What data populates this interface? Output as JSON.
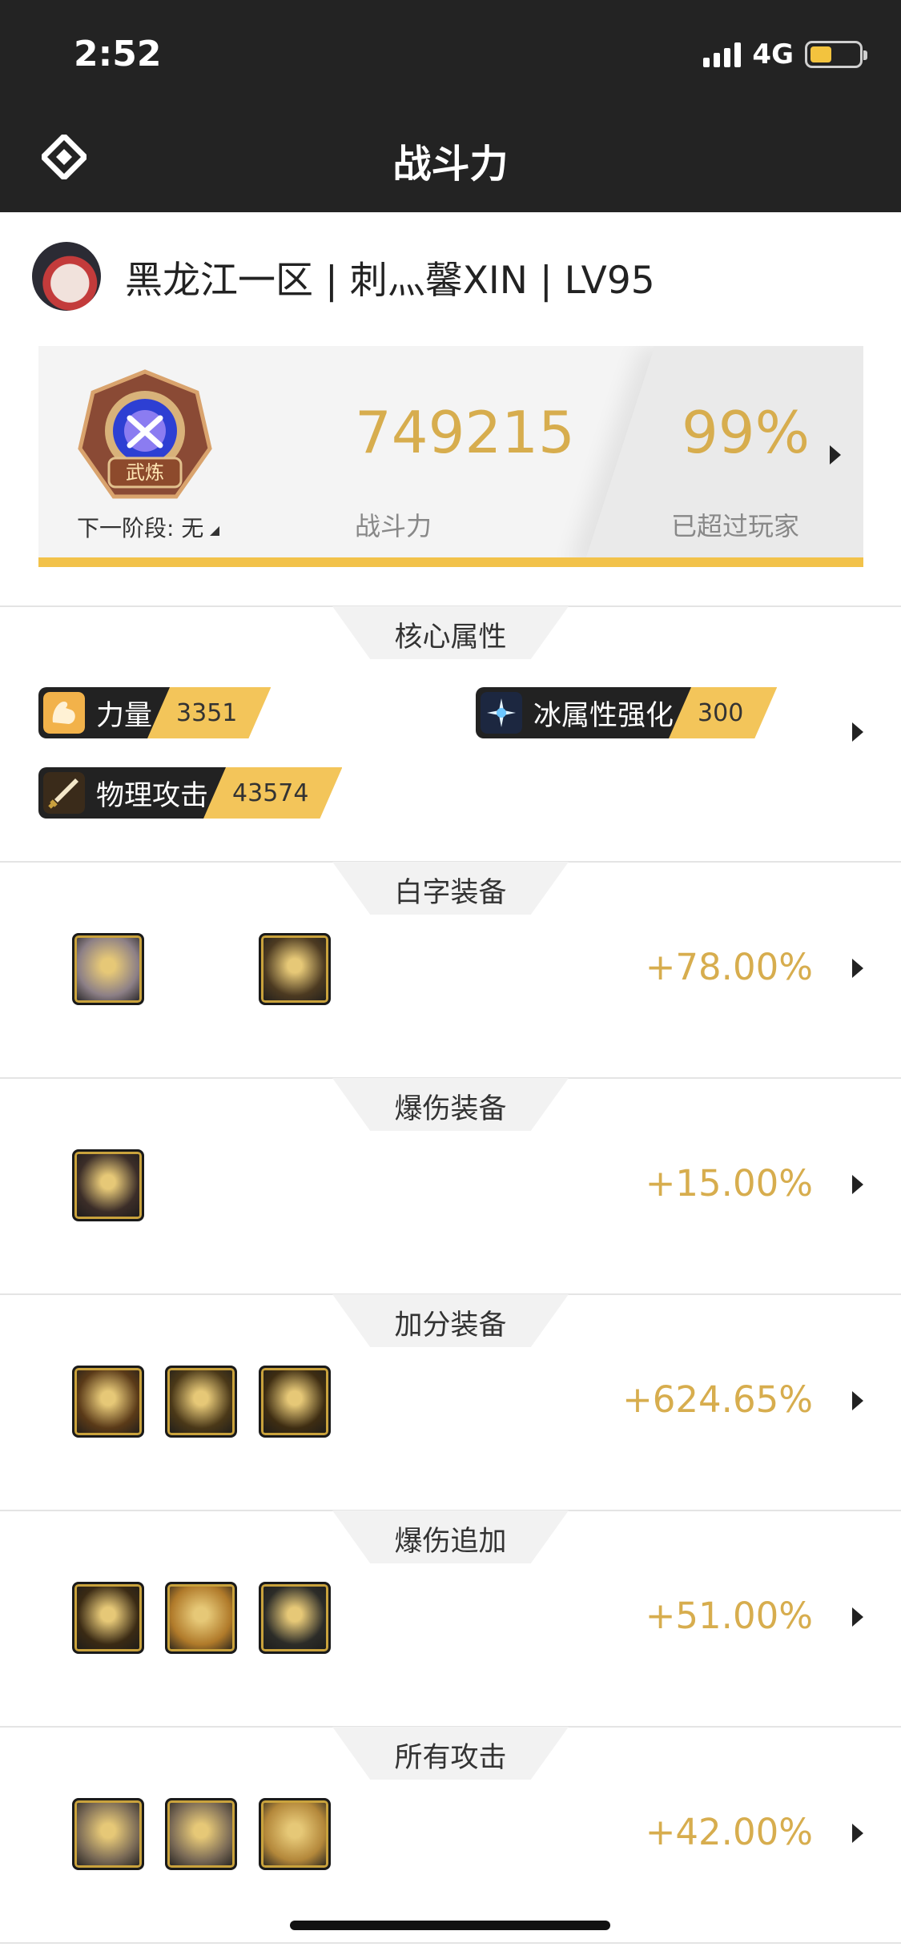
{
  "status_bar": {
    "time": "2:52",
    "network": "4G",
    "battery_level": 0.44
  },
  "nav": {
    "title": "战斗力",
    "logo_icon": "diamond-logo-icon"
  },
  "profile": {
    "name": "黑龙江一区 | 刺灬馨XIN | LV95",
    "avatar_icon": "character-avatar-icon"
  },
  "score_card": {
    "badge_text": "武炼",
    "next_stage": "下一阶段: 无",
    "score": "749215",
    "score_label": "战斗力",
    "percent": "99%",
    "percent_label": "已超过玩家"
  },
  "colors": {
    "accent": "#d7ad4e",
    "bar": "#f2c24a",
    "nav_bg": "#232323"
  },
  "core": {
    "title": "核心属性",
    "attrs": [
      {
        "label": "力量",
        "value": "3351",
        "icon": "strength-arm-icon"
      },
      {
        "label": "冰属性强化",
        "value": "300",
        "icon": "ice-sparkle-icon"
      },
      {
        "label": "物理攻击",
        "value": "43574",
        "icon": "sword-icon"
      }
    ]
  },
  "sections": [
    {
      "title": "白字装备",
      "bonus": "+78.00%",
      "items": [
        "white-equip-1-icon",
        "white-equip-2-icon"
      ]
    },
    {
      "title": "爆伤装备",
      "bonus": "+15.00%",
      "items": [
        "crit-equip-1-icon"
      ]
    },
    {
      "title": "加分装备",
      "bonus": "+624.65%",
      "items": [
        "bonus-equip-1-icon",
        "bonus-equip-2-icon",
        "bonus-equip-3-icon"
      ]
    },
    {
      "title": "爆伤追加",
      "bonus": "+51.00%",
      "items": [
        "crit-add-1-icon",
        "crit-add-2-icon",
        "crit-add-3-icon"
      ]
    },
    {
      "title": "所有攻击",
      "bonus": "+42.00%",
      "items": [
        "all-atk-1-icon",
        "all-atk-2-icon",
        "all-atk-3-icon"
      ]
    }
  ]
}
